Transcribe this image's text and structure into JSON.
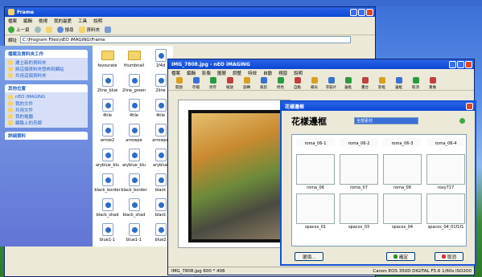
{
  "explorer": {
    "title": "Frame",
    "menu": [
      "檔案",
      "編輯",
      "檢視",
      "我的最愛",
      "工具",
      "說明"
    ],
    "toolbar": {
      "back": "上一頁",
      "search": "搜尋",
      "folders": "資料夾"
    },
    "address_label": "網址",
    "address": "C:\\Program Files\\nEO iMAGING\\Frame",
    "panel1_title": "檔案及資料夾工作",
    "panel1_items": [
      "建立新的資料夾",
      "將這個資料夾發佈到網站",
      "共用這個資料夾"
    ],
    "panel2_title": "其他位置",
    "panel2_items": [
      "nEO iMAGING",
      "我的文件",
      "共用文件",
      "我的電腦",
      "網路上的芳鄰"
    ],
    "panel3_title": "詳細資料",
    "files": [
      [
        "favourate",
        "thumbnail",
        "1f4d"
      ],
      [
        "2line_blue",
        "2line_green",
        "2line"
      ],
      [
        "4tile",
        "4tile",
        "4tile"
      ],
      [
        "arrow2",
        "arrowpe",
        "arrowpe"
      ],
      [
        "aryblue_blu",
        "aryblue_blu",
        "aryblue"
      ],
      [
        "black_border",
        "black_border",
        "black"
      ],
      [
        "black_shad",
        "black_shad",
        "black"
      ],
      [
        "blue1-1",
        "blue1-1",
        "blue2"
      ]
    ]
  },
  "viewer": {
    "title": "IMG_7808.jpg - nEO iMAGING",
    "menu": [
      "檔案",
      "編輯",
      "影像",
      "圖層",
      "調整",
      "特效",
      "自動",
      "視窗",
      "說明"
    ],
    "toolbar": [
      "開啟",
      "存檔",
      "另存",
      "縮放",
      "旋轉",
      "裁剪",
      "修色",
      "自動",
      "補光",
      "衣裝片",
      "邊框",
      "畫台",
      "影框",
      "邊框",
      "取消",
      "重做"
    ],
    "status": "IMG_7808.jpg 600 * 406",
    "status_right": "Canon EOS 350D DIGITAL F5.6 1/60s ISO200"
  },
  "dialog": {
    "title": "花樣邊框",
    "heading": "花樣邊框",
    "category": "全部素材",
    "frames": [
      "roma_06-1",
      "roma_06-2",
      "roma_06-3",
      "roma_06-4",
      "roma_06",
      "roma_07",
      "roma_08",
      "roxy717",
      "spacos_01",
      "spacos_03",
      "spacos_04",
      "spacos_04_01f1f1"
    ],
    "options_btn": "選項...",
    "ok_btn": "確定",
    "cancel_btn": "取消"
  },
  "colors": {
    "titlebar": "#0b47d4",
    "accent": "#215dc6"
  }
}
